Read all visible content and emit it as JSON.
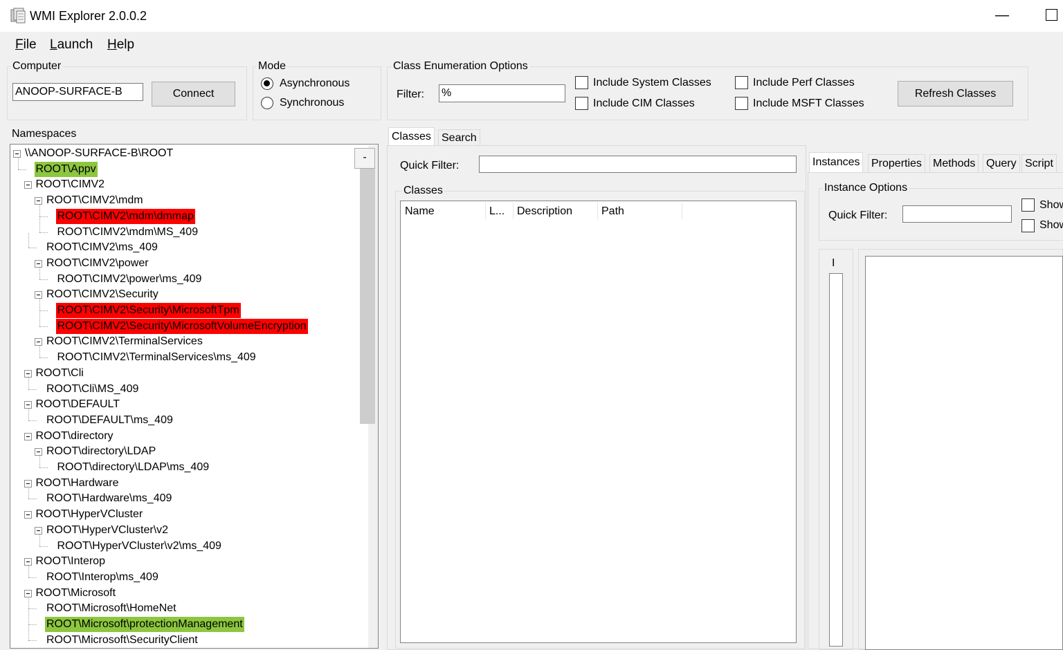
{
  "window": {
    "title": "WMI Explorer 2.0.0.2",
    "minimize": "—"
  },
  "menu": [
    {
      "label": "File",
      "accel": "F",
      "rest": "ile"
    },
    {
      "label": "Launch",
      "accel": "L",
      "rest": "aunch"
    },
    {
      "label": "Help",
      "accel": "H",
      "rest": "elp"
    }
  ],
  "computer": {
    "group_label": "Computer",
    "value": "ANOOP-SURFACE-B",
    "connect_label": "Connect"
  },
  "mode": {
    "group_label": "Mode",
    "options": [
      "Asynchronous",
      "Synchronous"
    ],
    "selected": "Asynchronous"
  },
  "class_enum": {
    "group_label": "Class Enumeration Options",
    "filter_label": "Filter:",
    "filter_value": "%",
    "checkboxes": [
      "Include System Classes",
      "Include CIM Classes",
      "Include Perf Classes",
      "Include MSFT Classes"
    ],
    "refresh_label": "Refresh Classes"
  },
  "namespaces": {
    "label": "Namespaces",
    "collapse_button": "-",
    "nodes": [
      {
        "text": "\\\\ANOOP-SURFACE-B\\ROOT",
        "highlight": ""
      },
      {
        "text": "ROOT\\Appv",
        "highlight": "green"
      },
      {
        "text": "ROOT\\CIMV2",
        "highlight": ""
      },
      {
        "text": "ROOT\\CIMV2\\mdm",
        "highlight": ""
      },
      {
        "text": "ROOT\\CIMV2\\mdm\\dmmap",
        "highlight": "red"
      },
      {
        "text": "ROOT\\CIMV2\\mdm\\MS_409",
        "highlight": ""
      },
      {
        "text": "ROOT\\CIMV2\\ms_409",
        "highlight": ""
      },
      {
        "text": "ROOT\\CIMV2\\power",
        "highlight": ""
      },
      {
        "text": "ROOT\\CIMV2\\power\\ms_409",
        "highlight": ""
      },
      {
        "text": "ROOT\\CIMV2\\Security",
        "highlight": ""
      },
      {
        "text": "ROOT\\CIMV2\\Security\\MicrosoftTpm",
        "highlight": "red"
      },
      {
        "text": "ROOT\\CIMV2\\Security\\MicrosoftVolumeEncryption",
        "highlight": "red"
      },
      {
        "text": "ROOT\\CIMV2\\TerminalServices",
        "highlight": ""
      },
      {
        "text": "ROOT\\CIMV2\\TerminalServices\\ms_409",
        "highlight": ""
      },
      {
        "text": "ROOT\\Cli",
        "highlight": ""
      },
      {
        "text": "ROOT\\Cli\\MS_409",
        "highlight": ""
      },
      {
        "text": "ROOT\\DEFAULT",
        "highlight": ""
      },
      {
        "text": "ROOT\\DEFAULT\\ms_409",
        "highlight": ""
      },
      {
        "text": "ROOT\\directory",
        "highlight": ""
      },
      {
        "text": "ROOT\\directory\\LDAP",
        "highlight": ""
      },
      {
        "text": "ROOT\\directory\\LDAP\\ms_409",
        "highlight": ""
      },
      {
        "text": "ROOT\\Hardware",
        "highlight": ""
      },
      {
        "text": "ROOT\\Hardware\\ms_409",
        "highlight": ""
      },
      {
        "text": "ROOT\\HyperVCluster",
        "highlight": ""
      },
      {
        "text": "ROOT\\HyperVCluster\\v2",
        "highlight": ""
      },
      {
        "text": "ROOT\\HyperVCluster\\v2\\ms_409",
        "highlight": ""
      },
      {
        "text": "ROOT\\Interop",
        "highlight": ""
      },
      {
        "text": "ROOT\\Interop\\ms_409",
        "highlight": ""
      },
      {
        "text": "ROOT\\Microsoft",
        "highlight": ""
      },
      {
        "text": "ROOT\\Microsoft\\HomeNet",
        "highlight": ""
      },
      {
        "text": "ROOT\\Microsoft\\protectionManagement",
        "highlight": "green"
      },
      {
        "text": "ROOT\\Microsoft\\SecurityClient",
        "highlight": ""
      }
    ]
  },
  "classes_tabs": [
    "Classes",
    "Search"
  ],
  "classes_panel": {
    "quick_filter_label": "Quick Filter:",
    "quick_filter_value": "",
    "group_label": "Classes",
    "columns": [
      "Name",
      "L...",
      "Description",
      "Path"
    ]
  },
  "right_tabs": [
    "Instances",
    "Properties",
    "Methods",
    "Query",
    "Script"
  ],
  "instances": {
    "group_label": "Instance Options",
    "quick_filter_label": "Quick Filter:",
    "quick_filter_value": "",
    "checkboxes": [
      "Show",
      "Show"
    ],
    "list_header": "I"
  },
  "colors": {
    "highlight_green": "#8dc63f",
    "highlight_red": "#ff0000"
  }
}
